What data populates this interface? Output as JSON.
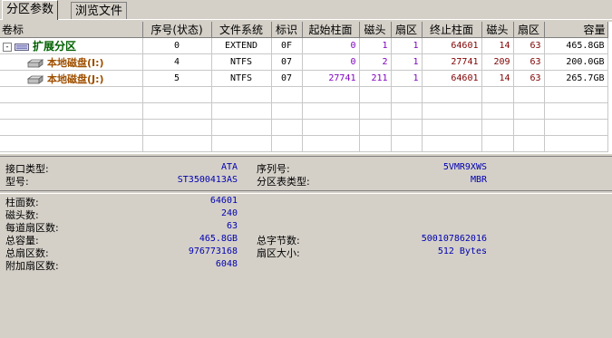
{
  "tabs": [
    "分区参数",
    "浏览文件"
  ],
  "columns": [
    "卷标",
    "序号(状态)",
    "文件系统",
    "标识",
    "起始柱面",
    "磁头",
    "扇区",
    "终止柱面",
    "磁头",
    "扇区",
    "容量"
  ],
  "rows": [
    {
      "label": "扩展分区",
      "index": "0",
      "fs": "EXTEND",
      "id": "0F",
      "start_cyl": "0",
      "start_head": "1",
      "start_sec": "1",
      "end_cyl": "64601",
      "end_head": "14",
      "end_sec": "63",
      "size": "465.8GB"
    },
    {
      "label": "本地磁盘(I:)",
      "index": "4",
      "fs": "NTFS",
      "id": "07",
      "start_cyl": "0",
      "start_head": "2",
      "start_sec": "1",
      "end_cyl": "27741",
      "end_head": "209",
      "end_sec": "63",
      "size": "200.0GB"
    },
    {
      "label": "本地磁盘(J:)",
      "index": "5",
      "fs": "NTFS",
      "id": "07",
      "start_cyl": "27741",
      "start_head": "211",
      "start_sec": "1",
      "end_cyl": "64601",
      "end_head": "14",
      "end_sec": "63",
      "size": "265.7GB"
    }
  ],
  "tree_toggle": "-",
  "info": {
    "interface_label": "接口类型:",
    "interface": "ATA",
    "serial_label": "序列号:",
    "serial": "5VMR9XWS",
    "model_label": "型号:",
    "model": "ST3500413AS",
    "ptable_label": "分区表类型:",
    "ptable": "MBR",
    "cylinders_label": "柱面数:",
    "cylinders": "64601",
    "heads_label": "磁头数:",
    "heads": "240",
    "spt_label": "每道扇区数:",
    "spt": "63",
    "capacity_label": "总容量:",
    "capacity": "465.8GB",
    "total_bytes_label": "总字节数:",
    "total_bytes": "500107862016",
    "sectors_label": "总扇区数:",
    "sectors": "976773168",
    "sector_size_label": "扇区大小:",
    "sector_size": "512 Bytes",
    "extra_label": "附加扇区数:",
    "extra": "6048"
  },
  "colors": {
    "extend": "#006000",
    "partition": "#a05000",
    "value": "#0000b0",
    "purple": "#8000c0",
    "red": "#800000"
  }
}
